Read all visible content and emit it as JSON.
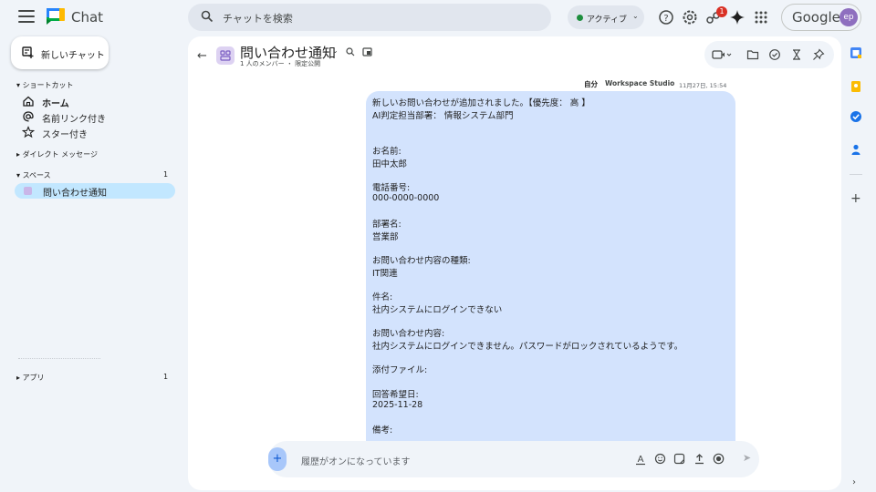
{
  "app": {
    "name": "Chat"
  },
  "search": {
    "placeholder": "チャットを検索"
  },
  "status": {
    "label": "アクティブ"
  },
  "notifications": {
    "count": "1"
  },
  "account": {
    "brand": "Google",
    "initials": "ep"
  },
  "sidebar": {
    "new_chat_label": "新しいチャット",
    "shortcuts_heading": "ショートカット",
    "shortcuts": [
      {
        "label": "ホーム",
        "icon": "home-icon"
      },
      {
        "label": "名前リンク付き",
        "icon": "at-sign-icon"
      },
      {
        "label": "スター付き",
        "icon": "star-icon"
      }
    ],
    "dm_heading": "ダイレクト メッセージ",
    "spaces_heading": "スペース",
    "spaces_count": "1",
    "spaces": [
      {
        "label": "問い合わせ通知"
      }
    ],
    "apps_heading": "アプリ",
    "apps_count": "1"
  },
  "space": {
    "title": "問い合わせ通知",
    "subtitle": "1 人のメンバー ・ 限定公開"
  },
  "message": {
    "self_label": "自分",
    "sender": "Workspace Studio",
    "time": "11月27日, 15:54",
    "lines": [
      "新しいお問い合わせが追加されました。【優先度： 高 】",
      "AI判定担当部署： 情報システム部門",
      "お名前:",
      "田中太郎",
      "電話番号:",
      "000-0000-0000",
      "部署名:",
      "営業部",
      "お問い合わせ内容の種類:",
      "IT関連",
      "件名:",
      "社内システムにログインできない",
      "お問い合わせ内容:",
      "社内システムにログインできません。パスワードがロックされているようです。",
      "添付ファイル:",
      "回答希望日:",
      "2025-11-28",
      "備考:"
    ]
  },
  "composer": {
    "placeholder": "履歴がオンになっています"
  },
  "colors": {
    "bubble": "#d3e3fd",
    "selected_space": "#c2e7ff",
    "active_dot": "#1e8e3e",
    "badge": "#d93025"
  }
}
